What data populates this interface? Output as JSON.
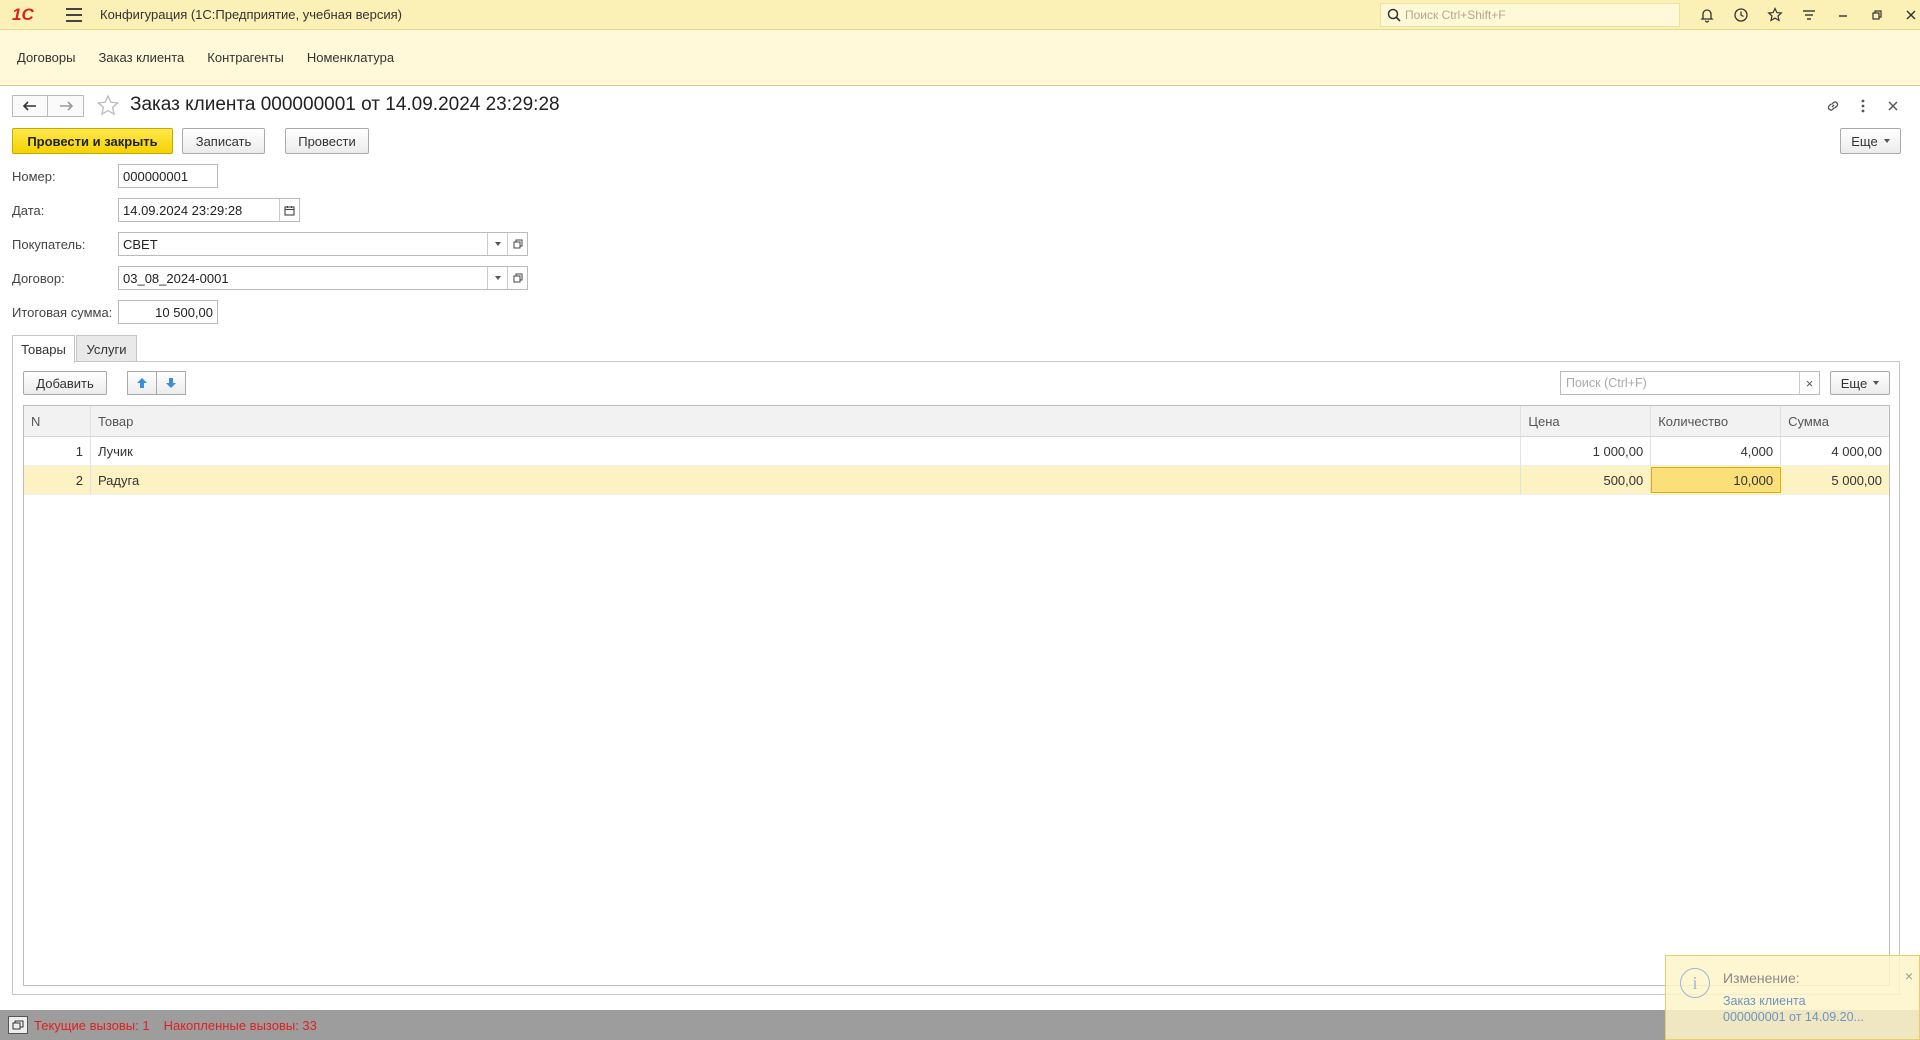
{
  "titlebar": {
    "logo": "1С",
    "app_title": "Конфигурация  (1С:Предприятие, учебная версия)",
    "search_placeholder": "Поиск Ctrl+Shift+F"
  },
  "sections": [
    "Договоры",
    "Заказ клиента",
    "Контрагенты",
    "Номенклатура"
  ],
  "form": {
    "title": "Заказ клиента 000000001 от 14.09.2024 23:29:28",
    "buttons": {
      "post_close": "Провести и закрыть",
      "save": "Записать",
      "post": "Провести",
      "more": "Еще"
    },
    "fields": {
      "number_label": "Номер:",
      "number": "000000001",
      "date_label": "Дата:",
      "date": "14.09.2024 23:29:28",
      "buyer_label": "Покупатель:",
      "buyer": "СВЕТ",
      "contract_label": "Договор:",
      "contract": "03_08_2024-0001",
      "total_label": "Итоговая сумма:",
      "total": "10 500,00"
    },
    "tabs": [
      "Товары",
      "Услуги"
    ]
  },
  "table": {
    "add_label": "Добавить",
    "search_placeholder": "Поиск (Ctrl+F)",
    "clear": "×",
    "more": "Еще",
    "columns": [
      "N",
      "Товар",
      "Цена",
      "Количество",
      "Сумма"
    ],
    "rows": [
      {
        "n": "1",
        "item": "Лучик",
        "price": "1 000,00",
        "qty": "4,000",
        "sum": "4 000,00"
      },
      {
        "n": "2",
        "item": "Радуга",
        "price": "500,00",
        "qty": "10,000",
        "sum": "5 000,00"
      }
    ]
  },
  "status": {
    "current": "Текущие вызовы: 1",
    "accumulated": "Накопленные вызовы: 33"
  },
  "notification": {
    "title": "Изменение:",
    "link_line1": "Заказ клиента",
    "link_line2": "000000001 от 14.09.20...",
    "close": "×"
  },
  "colors": {
    "title_bg": "#fbf0b5",
    "section_bg": "#fff9d9",
    "primary_button": "#f5d300",
    "selected_row": "#fdf2c3",
    "status_text": "#e02020"
  }
}
